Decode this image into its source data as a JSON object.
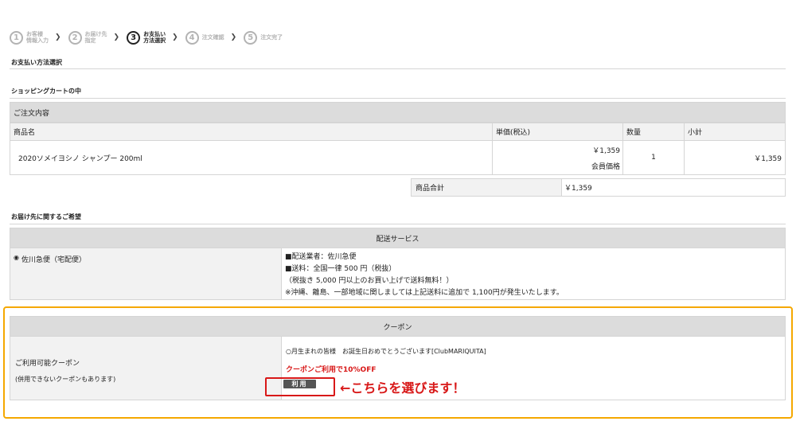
{
  "steps": [
    {
      "num": "1",
      "label": "お客様\n情報入力"
    },
    {
      "num": "2",
      "label": "お届け先\n指定"
    },
    {
      "num": "3",
      "label": "お支払い\n方法選択"
    },
    {
      "num": "4",
      "label": "注文確認"
    },
    {
      "num": "5",
      "label": "注文完了"
    }
  ],
  "active_step": 3,
  "page_title": "お支払い方法選択",
  "cart": {
    "title": "ショッピングカートの中",
    "header": "ご注文内容",
    "columns": [
      "商品名",
      "単価(税込)",
      "数量",
      "小計"
    ],
    "item": {
      "name": "2020ソメイヨシノ シャンプー 200ml",
      "price": "￥1,359",
      "member_label": "会員価格",
      "qty": "1",
      "subtotal": "￥1,359"
    },
    "total_label": "商品合計",
    "total_value": "￥1,359"
  },
  "delivery": {
    "title": "お届け先に関するご希望",
    "header": "配送サービス",
    "option": "佐川急便（宅配便）",
    "details": [
      "■配送業者：佐川急便",
      "■送料：全国一律 500 円（税抜）",
      "（税抜き 5,000 円以上のお買い上げで送料無料！）",
      "※沖縄、離島、一部地域に関しましては上記送料に追加で 1,100円が発生いたします。"
    ]
  },
  "coupon": {
    "header": "クーポン",
    "label": "ご利用可能クーポン",
    "note": "(併用できないクーポンもあります)",
    "option": "○月生まれの皆様　お誕生日おめでとうございます[ClubMARIQUITA]",
    "discount": "クーポンご利用で10%OFF",
    "button": "利用",
    "annotation": "←こちらを選びます！"
  },
  "colors": {
    "highlight": "#f5a800",
    "annotation_red": "#d81818",
    "header_gray": "#dcdcdc"
  }
}
